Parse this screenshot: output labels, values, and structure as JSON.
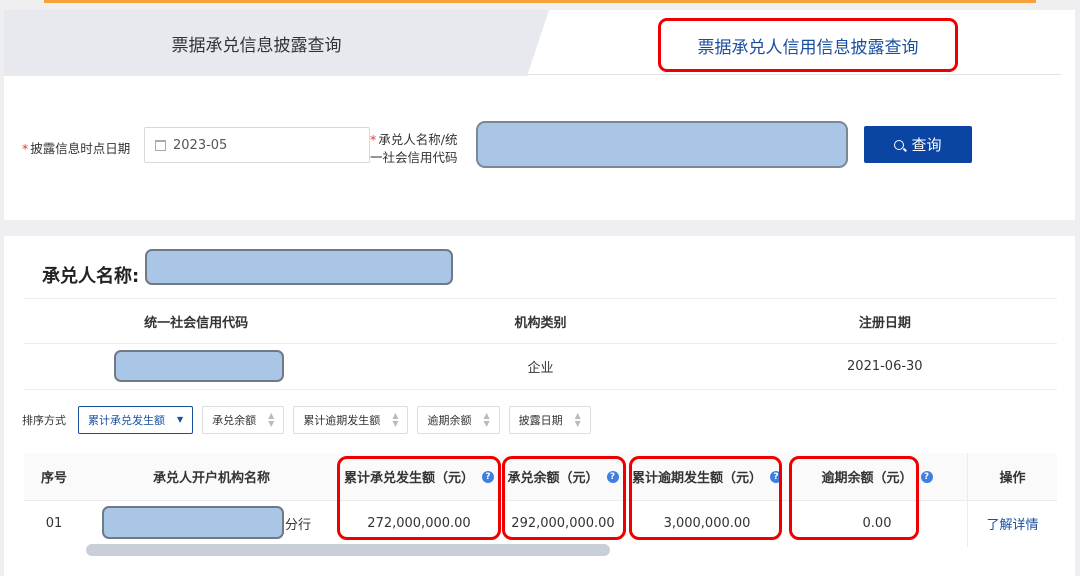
{
  "tabs": [
    {
      "label": "票据承兑信息披露查询",
      "active": false
    },
    {
      "label": "票据承兑人信用信息披露查询",
      "active": true
    }
  ],
  "form": {
    "date_label": "披露信息时点日期",
    "date_value": "2023-05",
    "name_label_line1": "承兑人名称/统",
    "name_label_line2": "一社会信用代码",
    "required_mark": "*",
    "query_label": "查询"
  },
  "detail": {
    "acceptor_label": "承兑人名称:",
    "info_headers": [
      "统一社会信用代码",
      "机构类别",
      "注册日期"
    ],
    "info_values": {
      "code": "",
      "category": "企业",
      "reg_date": "2021-06-30"
    }
  },
  "sort": {
    "label": "排序方式",
    "options": [
      "累计承兑发生额",
      "承兑余额",
      "累计逾期发生额",
      "逾期余额",
      "披露日期"
    ],
    "active_index": 0
  },
  "table": {
    "headers": [
      "序号",
      "承兑人开户机构名称",
      "累计承兑发生额（元）",
      "承兑余额（元）",
      "累计逾期发生额（元）",
      "逾期余额（元）",
      "操作"
    ],
    "rows": [
      {
        "no": "01",
        "branch_suffix": "分行",
        "cum_accept": "272,000,000.00",
        "balance": "292,000,000.00",
        "cum_overdue": "3,000,000.00",
        "overdue_balance": "0.00",
        "action": "了解详情"
      }
    ]
  },
  "colors": {
    "primary": "#0a45a3",
    "accent": "#f3a33a",
    "highlight": "#e00000",
    "redaction": "#a9c6e6"
  }
}
